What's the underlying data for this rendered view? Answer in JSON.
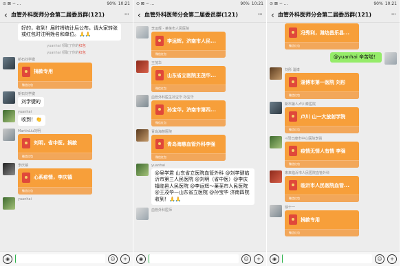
{
  "status": {
    "carrier": "⊙ ⊠ ∽ ...",
    "signal": "✱ ⚑ ▂▃▅",
    "battery": "90%",
    "time": "10:21"
  },
  "status_p2": {
    "battery": "90%",
    "time": "10:21"
  },
  "status_p3": {
    "battery": "90%",
    "time": "10:21"
  },
  "group_title": "血管外科医师分会第二届委员群(121)",
  "redpacket_foot": "微信红包",
  "phone1": {
    "top_text": "好的，收到！届时将统计后公布，请大家转张或红包时注明姓名和单位。🙏🙏",
    "sys1_user": "yuanhai",
    "sys1_text": "领取了你的",
    "sys1_hb": "红包",
    "sys2_user": "yuanhai",
    "sys2_text": "领取了你的",
    "sys2_hb": "红包",
    "m1_name": "新石刘学键",
    "m1_wish": "捐款专用",
    "m2_name": "新石刘学键",
    "m2_text": "刘学键的",
    "m3_name": "yuanhai",
    "m3_text": "收到！👏",
    "m4_name": "MartinLiu刘明",
    "m4_wish": "刘明，省中医，捐款",
    "m5_name": "李庆镇",
    "m5_wish": "心系疫情，李庆镇",
    "m6_name": "yuanhai"
  },
  "phone2": {
    "m1_name": "李运辉 - 莱芜市人民医院",
    "m1_wish": "李运辉，济南市人民...",
    "m2_name": "王茂华",
    "m2_wish": "山东省立医院王茂华...",
    "m3_name": "血管外科医生孙宝华 孙宝华",
    "m3_wish": "孙宝华，济南市第四...",
    "m4_name": "青岛海慈医院",
    "m4_wish": "青岛海慈血管外科李强",
    "m5_name": "yuanhai",
    "m5_text": "@吴学君 山东省立医院血管外科 @刘学键临沂市第三人民医院 @刘明（省中医）@李庆镇临邑人民医院 @李运辉～莱芜市人民医院 @王茂华—山东省立医院 @孙宝华 济南四院 收到！🙏🙏",
    "m6_name": "血管外科医师"
  },
  "phone3": {
    "m1_wish": "冯秀利，潍坊昌乐县...",
    "m2_text": "@yuanhai 辛苦啦！",
    "m3_name": "刘彤 淄博",
    "m3_wish": "淄博市第一医院 刘彤",
    "m4_name": "新市第人卢川泰医院",
    "m4_wish": "卢川 山一大放射学院",
    "m5_name": "✧阳日康市中心医院李强",
    "m5_wish": "疫情无情人有情 李强",
    "m6_name": "来来临沂市人民医院血管外科",
    "m6_wish": "临沂市人民医院血管...",
    "m7_name": "徐十一",
    "m7_wish": "捐款专用"
  },
  "icons": [
    "back-arrow-icon",
    "more-icon",
    "voice-icon",
    "emoji-icon",
    "plus-icon",
    "red-envelope-icon"
  ]
}
